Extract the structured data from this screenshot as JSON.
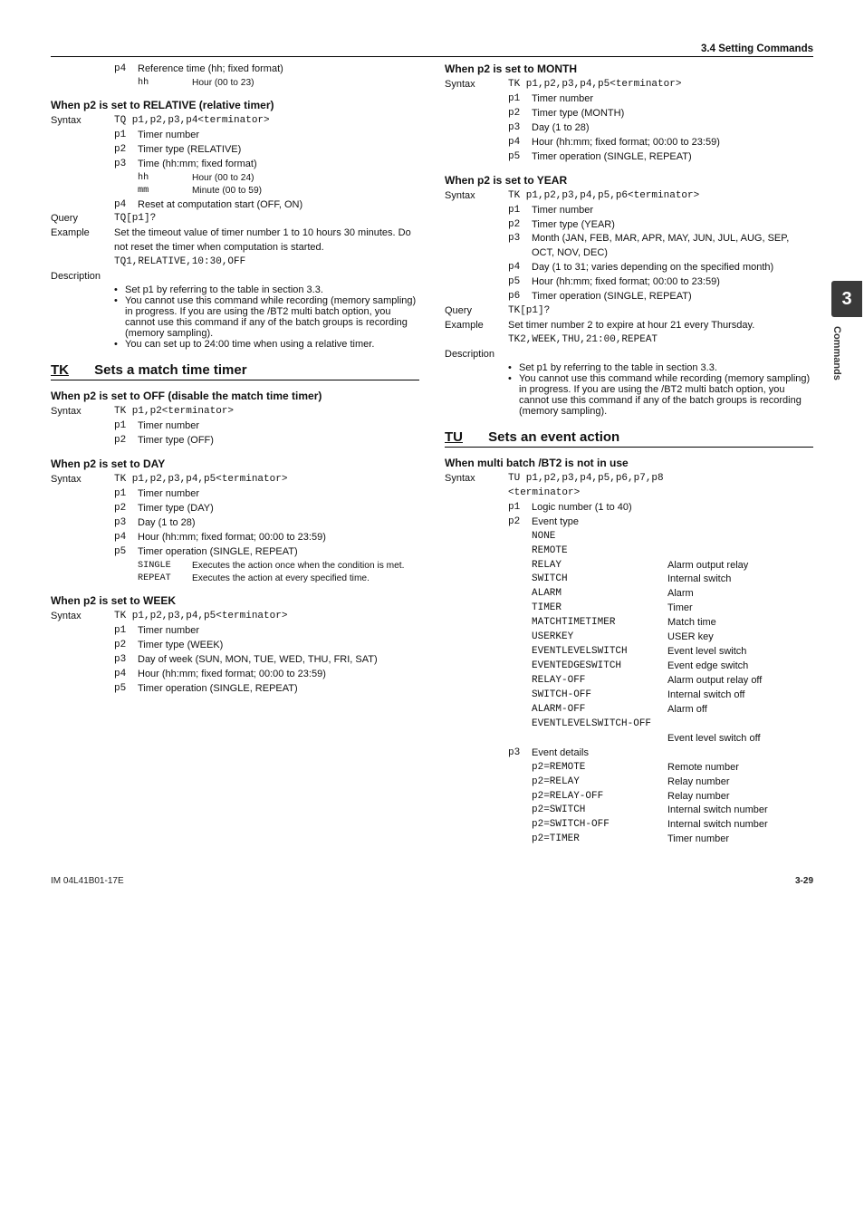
{
  "header": {
    "section": "3.4  Setting Commands"
  },
  "side_tab": {
    "number": "3",
    "label": "Commands"
  },
  "footer": {
    "left": "IM 04L41B01-17E",
    "page": "3-29"
  },
  "left": {
    "intro": {
      "p4": {
        "key": "p4",
        "text": "Reference time (hh; fixed format)"
      },
      "hh": {
        "key": "hh",
        "text": "Hour (00 to 23)"
      }
    },
    "relative": {
      "heading": "When p2 is set to RELATIVE (relative timer)",
      "syntax_label": "Syntax",
      "syntax": "TQ p1,p2,p3,p4<terminator>",
      "params": [
        {
          "k": "p1",
          "t": "Timer number"
        },
        {
          "k": "p2",
          "t": "Timer type (RELATIVE)"
        },
        {
          "k": "p3",
          "t": "Time (hh:mm; fixed format)"
        }
      ],
      "sub_hh": {
        "k": "hh",
        "t": "Hour (00 to 24)"
      },
      "sub_mm": {
        "k": "mm",
        "t": "Minute (00 to 59)"
      },
      "p4": {
        "k": "p4",
        "t": "Reset at computation start (OFF, ON)"
      },
      "query_label": "Query",
      "query": "TQ[p1]?",
      "example_label": "Example",
      "example_text": "Set the timeout value of timer number 1 to 10 hours 30 minutes. Do not reset the timer when computation is started.",
      "example_cmd": "TQ1,RELATIVE,10:30,OFF",
      "desc_label": "Description",
      "desc": [
        "Set p1 by referring to the table in section 3.3.",
        "You cannot use this command while recording (memory sampling) in progress. If you are using the /BT2 multi batch option, you cannot use this command if any of the batch groups is recording (memory sampling).",
        "You can set up to 24:00 time when using a relative timer."
      ]
    },
    "tk": {
      "sym": "TK",
      "title": "Sets a match time timer",
      "off_heading": "When p2 is set to OFF (disable the match time timer)",
      "off_syntax_label": "Syntax",
      "off_syntax": "TK p1,p2<terminator>",
      "off_params": [
        {
          "k": "p1",
          "t": "Timer number"
        },
        {
          "k": "p2",
          "t": "Timer type (OFF)"
        }
      ],
      "day_heading": "When p2 is set to DAY",
      "day_syntax_label": "Syntax",
      "day_syntax": "TK p1,p2,p3,p4,p5<terminator>",
      "day_params": [
        {
          "k": "p1",
          "t": "Timer number"
        },
        {
          "k": "p2",
          "t": "Timer type (DAY)"
        },
        {
          "k": "p3",
          "t": "Day (1 to 28)"
        },
        {
          "k": "p4",
          "t": "Hour (hh:mm; fixed format; 00:00 to 23:59)"
        },
        {
          "k": "p5",
          "t": "Timer operation (SINGLE, REPEAT)"
        }
      ],
      "single_k": "SINGLE",
      "single_t": "Executes the action once when the condition is met.",
      "repeat_k": "REPEAT",
      "repeat_t": "Executes the action at every specified time.",
      "week_heading": "When p2 is set to WEEK",
      "week_syntax_label": "Syntax",
      "week_syntax": "TK p1,p2,p3,p4,p5<terminator>",
      "week_params": [
        {
          "k": "p1",
          "t": "Timer number"
        },
        {
          "k": "p2",
          "t": "Timer type (WEEK)"
        },
        {
          "k": "p3",
          "t": "Day of week (SUN, MON, TUE, WED, THU, FRI, SAT)"
        },
        {
          "k": "p4",
          "t": "Hour (hh:mm; fixed format; 00:00 to 23:59)"
        },
        {
          "k": "p5",
          "t": "Timer operation (SINGLE, REPEAT)"
        }
      ]
    }
  },
  "right": {
    "month": {
      "heading": "When p2 is set to MONTH",
      "syntax_label": "Syntax",
      "syntax": "TK p1,p2,p3,p4,p5<terminator>",
      "params": [
        {
          "k": "p1",
          "t": "Timer number"
        },
        {
          "k": "p2",
          "t": "Timer type (MONTH)"
        },
        {
          "k": "p3",
          "t": "Day (1 to 28)"
        },
        {
          "k": "p4",
          "t": "Hour (hh:mm; fixed format; 00:00 to 23:59)"
        },
        {
          "k": "p5",
          "t": "Timer operation (SINGLE, REPEAT)"
        }
      ]
    },
    "year": {
      "heading": "When p2 is set to YEAR",
      "syntax_label": "Syntax",
      "syntax": "TK p1,p2,p3,p4,p5,p6<terminator>",
      "params": [
        {
          "k": "p1",
          "t": "Timer number"
        },
        {
          "k": "p2",
          "t": "Timer type (YEAR)"
        },
        {
          "k": "p3",
          "t": "Month (JAN, FEB, MAR, APR, MAY, JUN, JUL, AUG, SEP, OCT, NOV, DEC)"
        },
        {
          "k": "p4",
          "t": "Day (1 to 31; varies depending on the specified month)"
        },
        {
          "k": "p5",
          "t": "Hour (hh:mm; fixed format; 00:00 to 23:59)"
        },
        {
          "k": "p6",
          "t": "Timer operation (SINGLE, REPEAT)"
        }
      ],
      "query_label": "Query",
      "query": "TK[p1]?",
      "example_label": "Example",
      "example_text": "Set timer number 2 to expire at hour 21 every Thursday.",
      "example_cmd": "TK2,WEEK,THU,21:00,REPEAT",
      "desc_label": "Description",
      "desc": [
        "Set p1 by referring to the table in section 3.3.",
        "You cannot use this command while recording (memory sampling) in progress. If you are using the /BT2 multi batch option, you cannot use this command if any of the batch groups is recording (memory sampling)."
      ]
    },
    "tu": {
      "sym": "TU",
      "title": "Sets an event action",
      "sub": "When multi batch /BT2 is not in use",
      "syntax_label": "Syntax",
      "syntax1": "TU p1,p2,p3,p4,p5,p6,p7,p8",
      "syntax2": "<terminator>",
      "p1": {
        "k": "p1",
        "t": "Logic number (1 to 40)"
      },
      "p2": {
        "k": "p2",
        "t": "Event type"
      },
      "events": [
        {
          "k": "NONE",
          "v": ""
        },
        {
          "k": "REMOTE",
          "v": ""
        },
        {
          "k": "RELAY",
          "v": "Alarm output relay"
        },
        {
          "k": "SWITCH",
          "v": "Internal switch"
        },
        {
          "k": "ALARM",
          "v": "Alarm"
        },
        {
          "k": "TIMER",
          "v": "Timer"
        },
        {
          "k": "MATCHTIMETIMER",
          "v": "Match time"
        },
        {
          "k": "USERKEY",
          "v": "USER key"
        },
        {
          "k": "EVENTLEVELSWITCH",
          "v": "Event level switch"
        },
        {
          "k": "EVENTEDGESWITCH",
          "v": "Event edge switch"
        },
        {
          "k": "RELAY-OFF",
          "v": "Alarm output relay off"
        },
        {
          "k": "SWITCH-OFF",
          "v": "Internal switch off"
        },
        {
          "k": "ALARM-OFF",
          "v": "Alarm off"
        },
        {
          "k": "EVENTLEVELSWITCH-OFF",
          "v": ""
        }
      ],
      "event_off_v": "Event level switch off",
      "p3": {
        "k": "p3",
        "t": "Event details"
      },
      "details": [
        {
          "k": "p2=REMOTE",
          "v": "Remote number"
        },
        {
          "k": "p2=RELAY",
          "v": "Relay number"
        },
        {
          "k": "p2=RELAY-OFF",
          "v": "Relay number"
        },
        {
          "k": "p2=SWITCH",
          "v": "Internal switch number"
        },
        {
          "k": "p2=SWITCH-OFF",
          "v": "Internal switch number"
        },
        {
          "k": "p2=TIMER",
          "v": "Timer number"
        }
      ]
    }
  }
}
